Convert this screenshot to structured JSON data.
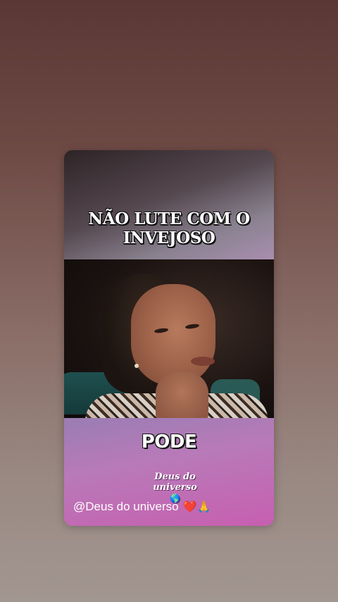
{
  "post": {
    "headline": "NÃO LUTE COM O\nINVEJOSO",
    "caption": "PODE",
    "watermark": {
      "line1": "Deus do",
      "line2": "universo",
      "icon": "globe-icon",
      "glyph": "🌎"
    },
    "handle": "@Deus do universo",
    "emojis": "❤️🙏"
  },
  "colors": {
    "background_top": "#5a3735",
    "background_bottom": "#a29690",
    "caption_band": "#c75fb0",
    "text": "#ffffff"
  }
}
